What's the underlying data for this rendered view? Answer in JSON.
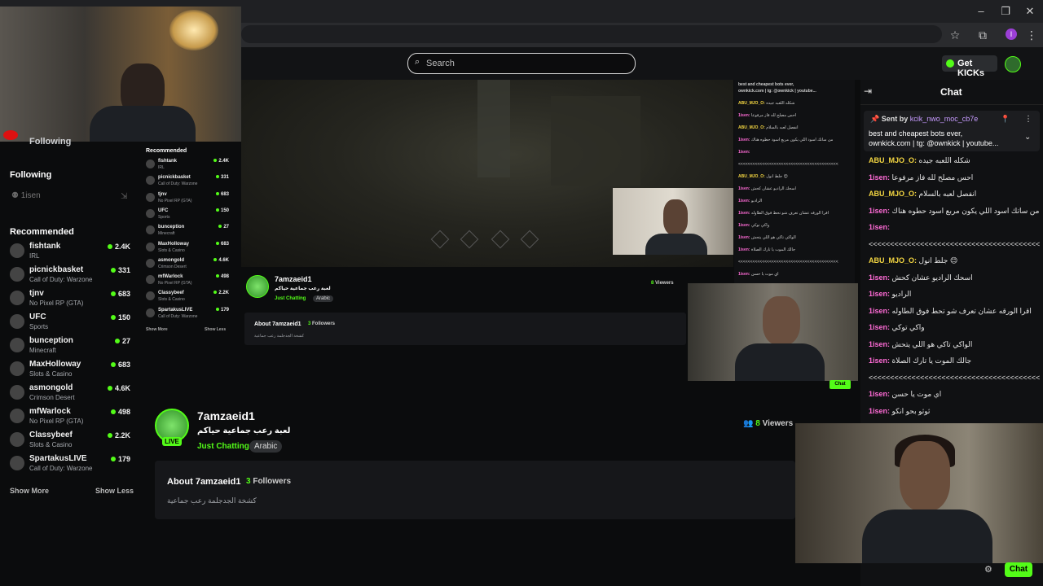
{
  "header": {
    "search_placeholder": "Search",
    "get_kicks_label": "Get KICKs",
    "profile_letter": "I"
  },
  "webcam": {
    "following_partial": "Following"
  },
  "sidebar": {
    "following_heading": "Following",
    "followed_channel": "1isen",
    "recommended_heading": "Recommended",
    "items": [
      {
        "name": "fishtank",
        "category": "IRL",
        "viewers": "2.4K"
      },
      {
        "name": "picnickbasket",
        "category": "Call of Duty: Warzone",
        "viewers": "331"
      },
      {
        "name": "tjnv",
        "category": "No Pixel RP (GTA)",
        "viewers": "683"
      },
      {
        "name": "UFC",
        "category": "Sports",
        "viewers": "150"
      },
      {
        "name": "bunception",
        "category": "Minecraft",
        "viewers": "27"
      },
      {
        "name": "MaxHolloway",
        "category": "Slots & Casino",
        "viewers": "683"
      },
      {
        "name": "asmongold",
        "category": "Crimson Desert",
        "viewers": "4.6K"
      },
      {
        "name": "mfWarlock",
        "category": "No Pixel RP (GTA)",
        "viewers": "498"
      },
      {
        "name": "Classybeef",
        "category": "Slots & Casino",
        "viewers": "2.2K"
      },
      {
        "name": "SpartakusLIVE",
        "category": "Call of Duty: Warzone",
        "viewers": "179"
      }
    ],
    "show_more": "Show More",
    "show_less": "Show Less"
  },
  "mini": {
    "recommended_heading": "Recommended",
    "items": [
      {
        "name": "fishtank",
        "category": "IRL",
        "viewers": "2.4K"
      },
      {
        "name": "picnickbasket",
        "category": "Call of Duty: Warzone",
        "viewers": "331"
      },
      {
        "name": "tjnv",
        "category": "No Pixel RP (GTA)",
        "viewers": "683"
      },
      {
        "name": "UFC",
        "category": "Sports",
        "viewers": "150"
      },
      {
        "name": "bunception",
        "category": "Minecraft",
        "viewers": "27"
      },
      {
        "name": "MaxHolloway",
        "category": "Slots & Casino",
        "viewers": "683"
      },
      {
        "name": "asmongold",
        "category": "Crimson Desert",
        "viewers": "4.6K"
      },
      {
        "name": "mfWarlock",
        "category": "No Pixel RP (GTA)",
        "viewers": "498"
      },
      {
        "name": "Classybeef",
        "category": "Slots & Casino",
        "viewers": "2.2K"
      },
      {
        "name": "SpartakusLIVE",
        "category": "Call of Duty: Warzone",
        "viewers": "179"
      }
    ],
    "show_more": "Show More",
    "show_less": "Show Less",
    "channel_name": "7amzaeid1",
    "stream_title": "لعبة رعب جماعية حياكم",
    "category": "Just Chatting",
    "tag": "Arabic",
    "viewers": "8",
    "viewers_label": "Viewers",
    "about_title": "About 7amzaeid1",
    "followers": "3",
    "followers_label": "Followers",
    "about_desc": "كشخة الجدجلمة رعب جماعية",
    "pinned_line1": "best and cheapest bots ever,",
    "pinned_line2": "ownkick.com | tg: @ownkick | youtube...",
    "chat_label": "Chat"
  },
  "channel": {
    "name": "7amzaeid1",
    "live_label": "LIVE",
    "stream_title": "لعبة رعب جماعية حياكم",
    "category": "Just Chatting",
    "tag": "Arabic",
    "viewers": "8",
    "viewers_label": "Viewers",
    "about_title": "About 7amzaeid1",
    "followers": "3",
    "followers_label": "Followers",
    "about_desc": "كشخة الجدجلمة رعب جماعية"
  },
  "chat": {
    "title": "Chat",
    "pinned_sent_by": "Sent by",
    "pinned_user": "kcik_nwo_moc_cb7e",
    "pinned_text_line1": "best and cheapest bots ever,",
    "pinned_text_line2": "ownkick.com | tg: @ownkick | youtube...",
    "messages": [
      {
        "user": "ABU_MJO_O:",
        "color": "#f5d742",
        "text": "شكله اللعبه جيده"
      },
      {
        "user": "1isen:",
        "color": "#ff6bd6",
        "text": "احس مصلح لله فاز مرفوعا"
      },
      {
        "user": "ABU_MJO_O:",
        "color": "#f5d742",
        "text": "انفصل لعبه بالسلام"
      },
      {
        "user": "1isen:",
        "color": "#ff6bd6",
        "text": "من ساتك اسود اللي يكون مربع اسود حطوه هناك"
      },
      {
        "user": "1isen:",
        "color": "#ff6bd6",
        "text": ""
      },
      {
        "user": "",
        "color": "#ff6bd6",
        "text": "<<<<<<<<<<<<<<<<<<<<<<<<<<<<<<<<<<<<<<<<<<"
      },
      {
        "user": "ABU_MJO_O:",
        "color": "#f5d742",
        "text": "جلط انول 😊"
      },
      {
        "user": "1isen:",
        "color": "#ff6bd6",
        "text": "اسحك الراديو عشان كحش"
      },
      {
        "user": "1isen:",
        "color": "#ff6bd6",
        "text": "الراديو"
      },
      {
        "user": "1isen:",
        "color": "#ff6bd6",
        "text": "اقرا الورقه عشان تعرف شو تحط فوق الطاوله"
      },
      {
        "user": "1isen:",
        "color": "#ff6bd6",
        "text": "واكي توكي"
      },
      {
        "user": "1isen:",
        "color": "#ff6bd6",
        "text": "الواكي تاكي هو اللي يتحش"
      },
      {
        "user": "1isen:",
        "color": "#ff6bd6",
        "text": "جالك الموت يا تارك الصلاة"
      },
      {
        "user": "",
        "color": "#ff6bd6",
        "text": "<<<<<<<<<<<<<<<<<<<<<<<<<<<<<<<<<<<<<<<<<<"
      },
      {
        "user": "1isen:",
        "color": "#ff6bd6",
        "text": "اي موت يا حسن"
      },
      {
        "user": "1isen:",
        "color": "#ff6bd6",
        "text": "ثوثو بحو انكو"
      }
    ],
    "chat_button": "Chat"
  }
}
